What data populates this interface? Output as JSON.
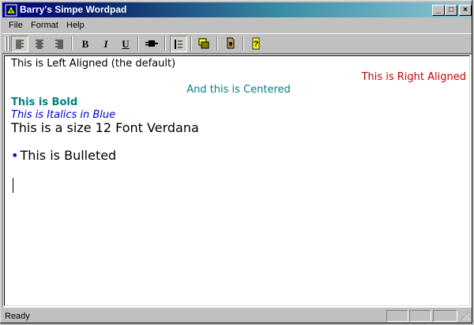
{
  "window": {
    "title": "Barry's Simpe Wordpad",
    "controls": {
      "minimize": "_",
      "maximize": "□",
      "close": "×"
    }
  },
  "menu": [
    "File",
    "Format",
    "Help"
  ],
  "toolbar": {
    "buttons": [
      "align-left-icon",
      "align-center-icon",
      "align-right-icon",
      "bold-icon",
      "italic-icon",
      "underline-icon",
      "font-plug-icon",
      "bullet-list-icon",
      "color-swap-icon",
      "insert-object-icon",
      "help-icon"
    ],
    "labels": {
      "bold": "B",
      "italic": "I",
      "underline": "U",
      "help": "?"
    }
  },
  "document": {
    "lines": [
      {
        "text": "This is Left Aligned (the default)",
        "align": "left",
        "color": "#000000"
      },
      {
        "text": "This is Right Aligned",
        "align": "right",
        "color": "#cc0000"
      },
      {
        "text": "And this is Centered",
        "align": "center",
        "color": "#008080"
      },
      {
        "text": "This is Bold",
        "align": "left",
        "color": "#008080",
        "weight": "bold"
      },
      {
        "text": "This is Italics in Blue",
        "align": "left",
        "color": "#0000cc",
        "style": "italic"
      },
      {
        "text": "This is a size 12 Font Verdana",
        "align": "left",
        "color": "#000000"
      },
      {
        "text": "This is Bulleted",
        "align": "left",
        "color": "#000000",
        "bullet": "•"
      }
    ]
  },
  "status": {
    "text": "Ready"
  },
  "colors": {
    "titlebar_start": "#000080",
    "titlebar_end": "#8ec6d6",
    "face": "#c0c0c0"
  }
}
